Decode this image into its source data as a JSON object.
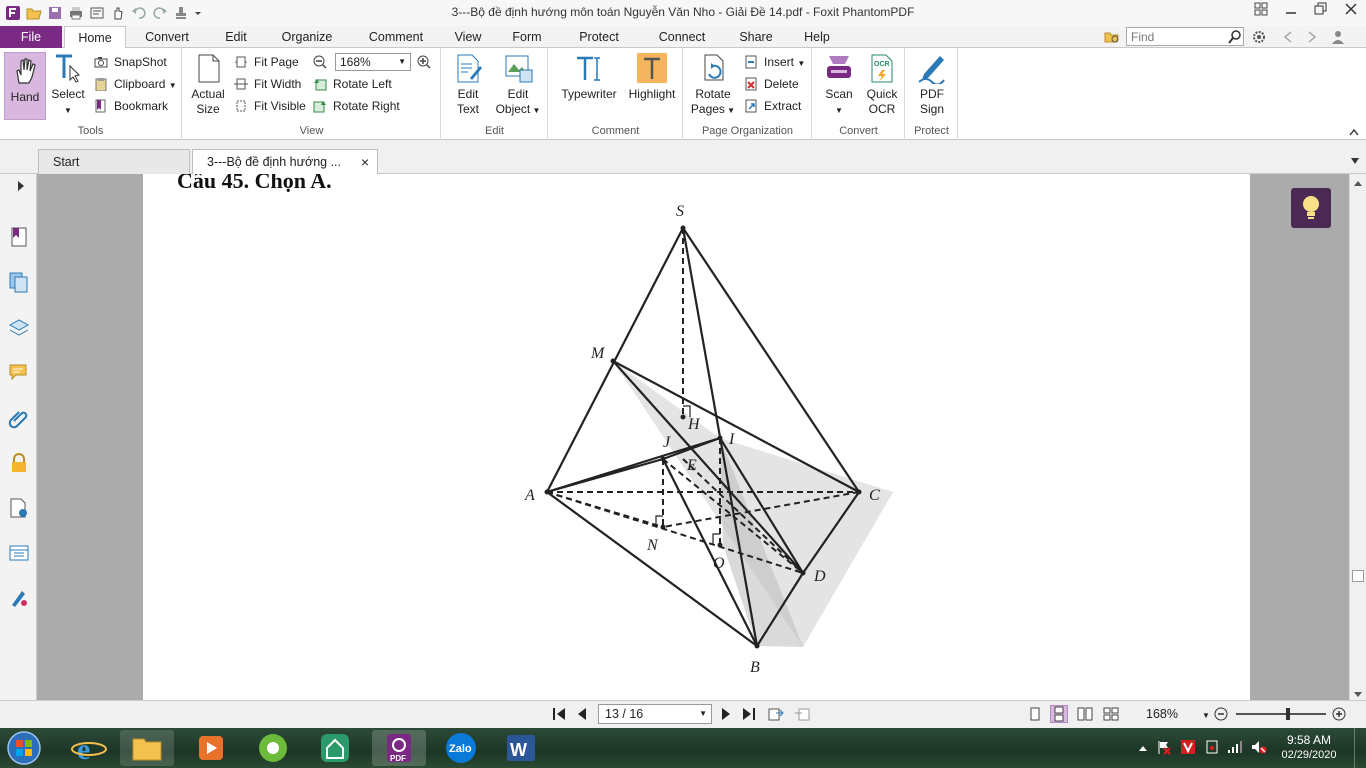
{
  "window": {
    "title": "3---Bộ đề định hướng môn toán Nguyễn Văn Nho - Giải Đề 14.pdf - Foxit PhantomPDF"
  },
  "menu": {
    "tabs": [
      "File",
      "Home",
      "Convert",
      "Edit",
      "Organize",
      "Comment",
      "View",
      "Form",
      "Protect",
      "Connect",
      "Share",
      "Help"
    ],
    "find_placeholder": "Find"
  },
  "ribbon": {
    "tools": {
      "label": "Tools",
      "hand": "Hand",
      "select": "Select",
      "snapshot": "SnapShot",
      "clipboard": "Clipboard",
      "bookmark": "Bookmark"
    },
    "view": {
      "label": "View",
      "actual1": "Actual",
      "actual2": "Size",
      "fit_page": "Fit Page",
      "fit_width": "Fit Width",
      "fit_visible": "Fit Visible",
      "zoom": "168%",
      "rotate_left": "Rotate Left",
      "rotate_right": "Rotate Right"
    },
    "edit": {
      "label": "Edit",
      "edit_text1": "Edit",
      "edit_text2": "Text",
      "edit_object1": "Edit",
      "edit_object2": "Object"
    },
    "comment": {
      "label": "Comment",
      "typewriter": "Typewriter",
      "highlight": "Highlight"
    },
    "page_org": {
      "label": "Page Organization",
      "rotate1": "Rotate",
      "rotate2": "Pages",
      "insert": "Insert",
      "delete": "Delete",
      "extract": "Extract"
    },
    "convert": {
      "label": "Convert",
      "scan": "Scan",
      "ocr1": "Quick",
      "ocr2": "OCR",
      "ocr_badge": "OCR"
    },
    "protect": {
      "label": "Protect",
      "sign1": "PDF",
      "sign2": "Sign"
    }
  },
  "doc_tabs": {
    "start": "Start",
    "document": "3---Bộ đề định hướng ...",
    "close": "×"
  },
  "document": {
    "heading": "Câu 45. Chọn A.",
    "vertices": [
      "S",
      "M",
      "H",
      "J",
      "I",
      "E",
      "A",
      "C",
      "N",
      "O",
      "D",
      "B"
    ]
  },
  "statusbar": {
    "page_indicator": "13 / 16",
    "zoom": "168%"
  },
  "taskbar": {
    "zalo": "Zalo",
    "pdf_badge": "PDF",
    "time": "9:58 AM",
    "date": "02/29/2020"
  },
  "colors": {
    "accent": "#7a2a82",
    "hand_active": "#d9b8e0",
    "taskbar": "#1d3627"
  }
}
